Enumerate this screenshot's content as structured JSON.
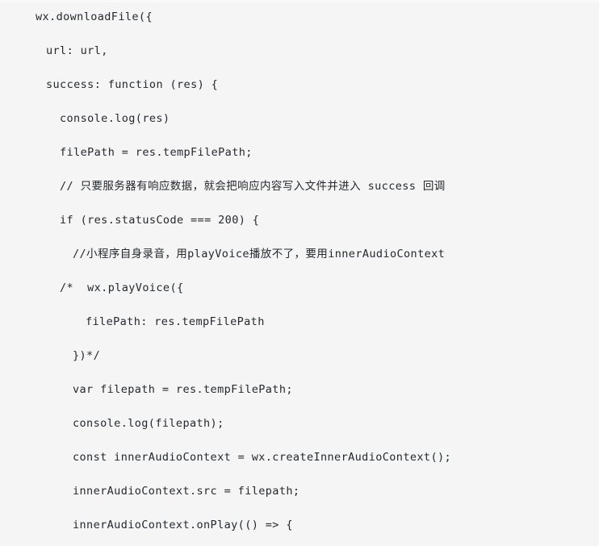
{
  "document": {
    "type": "code-snippet",
    "language": "javascript",
    "background_color": "#f5f5f5",
    "text_color": "#24292e",
    "lines": [
      {
        "indent": 0,
        "text": "wx.downloadFile({"
      },
      {
        "indent": 1,
        "text": "url: url,"
      },
      {
        "indent": 1,
        "text": "success: function (res) {"
      },
      {
        "indent": 2,
        "text": "console.log(res)"
      },
      {
        "indent": 2,
        "text": "filePath = res.tempFilePath;"
      },
      {
        "indent": 2,
        "text": "// 只要服务器有响应数据，就会把响应内容写入文件并进入 success 回调"
      },
      {
        "indent": 2,
        "text": "if (res.statusCode === 200) {"
      },
      {
        "indent": 3,
        "text": "//小程序自身录音，用playVoice播放不了，要用innerAudioContext"
      },
      {
        "indent": 2,
        "text": "/*  wx.playVoice({"
      },
      {
        "indent": 4,
        "text": "filePath: res.tempFilePath"
      },
      {
        "indent": 3,
        "text": "})*/"
      },
      {
        "indent": 3,
        "text": "var filepath = res.tempFilePath;"
      },
      {
        "indent": 3,
        "text": "console.log(filepath);"
      },
      {
        "indent": 3,
        "text": "const innerAudioContext = wx.createInnerAudioContext();"
      },
      {
        "indent": 3,
        "text": "innerAudioContext.src = filepath;"
      },
      {
        "indent": 3,
        "text": "innerAudioContext.onPlay(() => {"
      }
    ]
  }
}
